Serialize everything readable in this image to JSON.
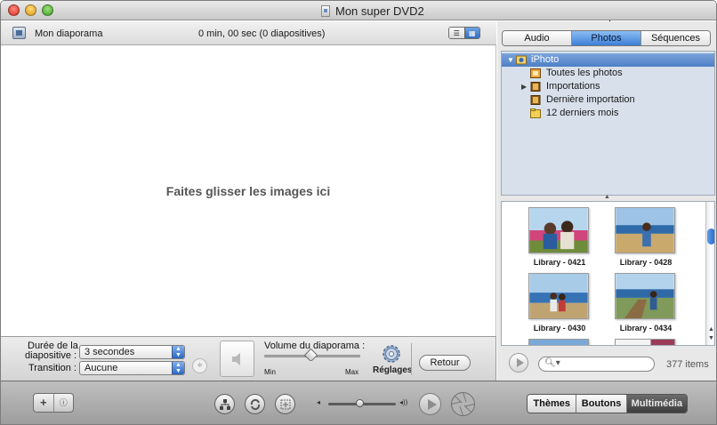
{
  "window": {
    "title": "Mon super DVD2"
  },
  "project": {
    "name": "Mon diaporama",
    "info": "0 min, 00 sec (0 diapositives)"
  },
  "drop_area": {
    "message": "Faites glisser les images ici"
  },
  "controls": {
    "duration_label_1": "Durée de la",
    "duration_label_2": "diapositive :",
    "duration_value": "3 secondes",
    "transition_label": "Transition :",
    "transition_value": "Aucune",
    "volume_label": "Volume du diaporama :",
    "volume_min": "Min",
    "volume_max": "Max",
    "settings_label": "Réglages",
    "back_label": "Retour"
  },
  "media_tabs": [
    {
      "label": "Audio",
      "active": false
    },
    {
      "label": "Photos",
      "active": true
    },
    {
      "label": "Séquences",
      "active": false
    }
  ],
  "source_list": [
    {
      "label": "iPhoto",
      "selected": true,
      "icon": "iphoto-icon"
    },
    {
      "label": "Toutes les photos",
      "icon": "photo-library-icon"
    },
    {
      "label": "Importations",
      "icon": "film-roll-icon"
    },
    {
      "label": "Dernière importation",
      "icon": "film-roll-icon"
    },
    {
      "label": "12 derniers mois",
      "icon": "calendar-folder-icon"
    }
  ],
  "photos": [
    {
      "caption": "Library - 0421"
    },
    {
      "caption": "Library - 0428"
    },
    {
      "caption": "Library - 0430"
    },
    {
      "caption": "Library - 0434"
    }
  ],
  "browser_footer": {
    "items_count": "377 items"
  },
  "bottom_bar": {
    "segments": [
      {
        "label": "Thèmes",
        "active": false
      },
      {
        "label": "Boutons",
        "active": false
      },
      {
        "label": "Multimédia",
        "active": true
      }
    ]
  }
}
